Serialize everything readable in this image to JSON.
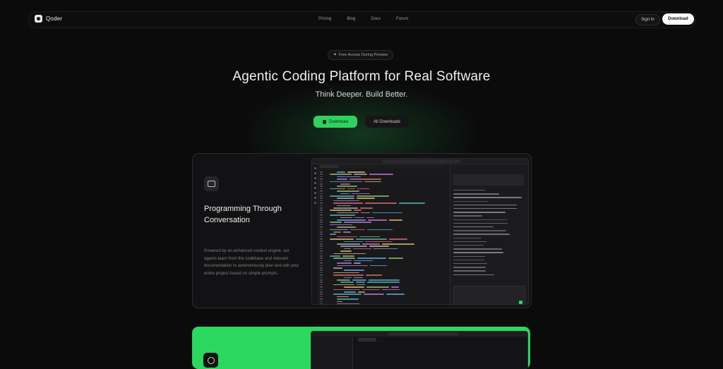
{
  "nav": {
    "brand": "Qoder",
    "links": [
      "Pricing",
      "Blog",
      "Docs",
      "Forum"
    ],
    "signin": "Sign In",
    "download": "Download"
  },
  "hero": {
    "badge": "Free Access During Preview",
    "title": "Agentic Coding Platform for Real Software",
    "subtitle": "Think Deeper. Build Better.",
    "primary_button": "Download",
    "secondary_button": "All Downloads"
  },
  "feature": {
    "title": "Programming Through Conversation",
    "description": "Powered by an enhanced context engine, our agents learn from the codebase and relevant documentation to autonomously plan and edit your entire project based on simple prompts."
  },
  "colors": {
    "background": "#0b0b0c",
    "accent": "#2ed35f",
    "card": "#121214"
  },
  "icons": [
    "qoder-logo-icon",
    "sparkle-icon",
    "apple-icon",
    "chat-icon",
    "sparkle-circle-icon"
  ]
}
